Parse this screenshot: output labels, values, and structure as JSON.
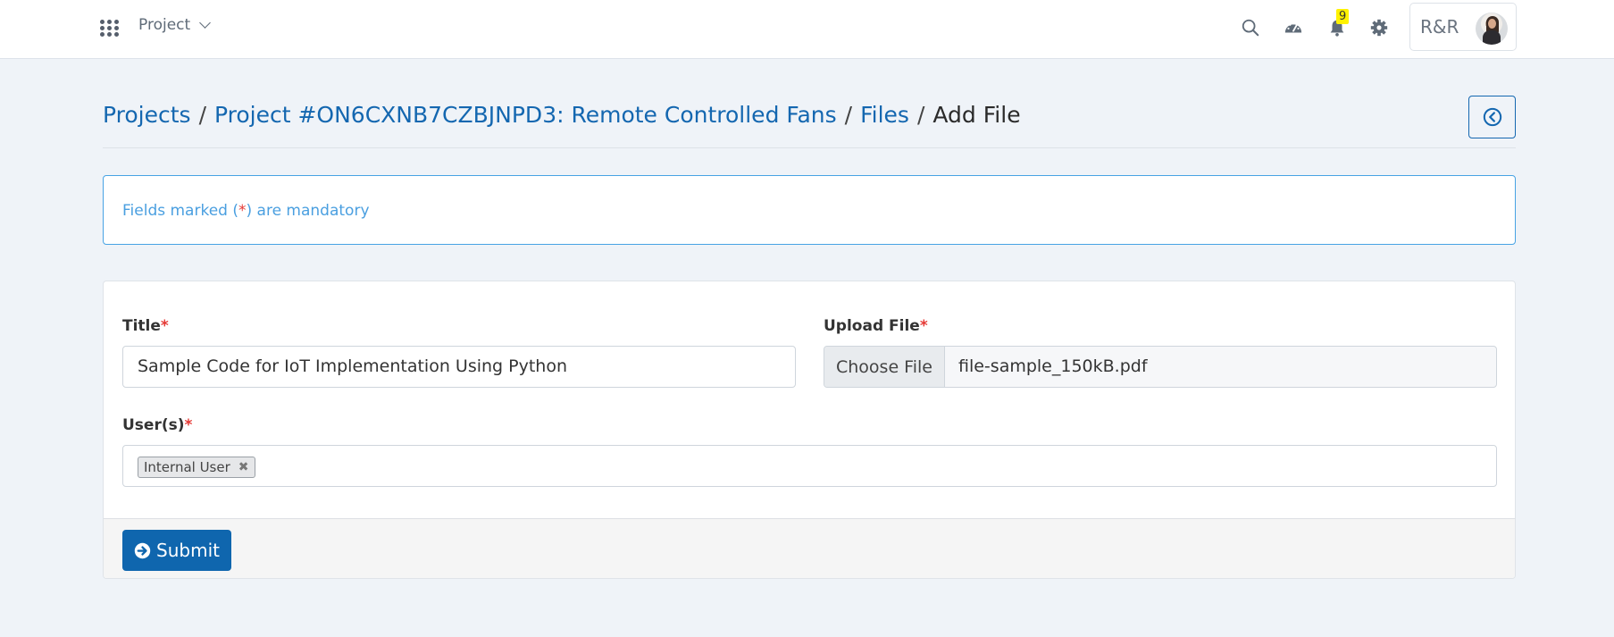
{
  "navbar": {
    "menu_label": "Project",
    "icons": [
      "apps-grid-icon",
      "search-icon",
      "dashboard-icon",
      "bell-icon",
      "gear-icon"
    ],
    "notification_count": "9",
    "user_initials": "R&R"
  },
  "breadcrumb": {
    "items": [
      "Projects",
      "Project #ON6CXNB7CZBJNPD3: Remote Controlled Fans",
      "Files"
    ],
    "separator": "/",
    "current": "Add File"
  },
  "alert": {
    "prefix": "Fields marked (",
    "asterisk": "*",
    "suffix": ") are mandatory"
  },
  "form": {
    "title_label": "Title",
    "title_value": "Sample Code for IoT Implementation Using Python",
    "upload_label": "Upload File",
    "choose_file_label": "Choose File",
    "file_name": "file-sample_150kB.pdf",
    "users_label": "User(s)",
    "selected_users": [
      "Internal User"
    ],
    "required_mark": "*",
    "submit_label": "Submit"
  },
  "colors": {
    "primary": "#0f66ae",
    "link": "#1467b0",
    "alert_border": "#48a3e4",
    "required": "#e53935",
    "badge": "#fff200"
  }
}
